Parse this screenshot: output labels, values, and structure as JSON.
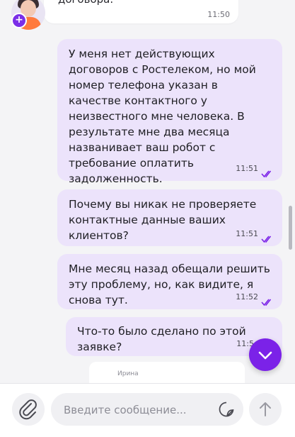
{
  "chat": {
    "incoming_partial": {
      "text": "договора.",
      "time": "11:50"
    },
    "messages": [
      {
        "text": "У меня нет действующих договоров с Ростелеком, но мой номер телефона указан в качестве контактного у неизвестного мне человека. В результате мне два месяца названивает ваш робот с требование оплатить задолженность.",
        "time": "11:51"
      },
      {
        "text": "Почему вы никак не проверяете контактные данные ваших клиентов?",
        "time": "11:51"
      },
      {
        "text": "Мне месяц назад обещали решить эту проблему, но, как видите, я снова тут.",
        "time": "11:52"
      },
      {
        "text": "Что-то было сделано по этой заявке?",
        "time": "11:5"
      }
    ],
    "preview_name": "Ирина"
  },
  "composer": {
    "placeholder": "Введите сообщение..."
  },
  "colors": {
    "accent": "#7b22e8",
    "outgoing_bubble": "#ece3fb",
    "incoming_bubble": "#ffffff",
    "background": "#f4f4f6"
  },
  "icons": {
    "attach": "paperclip-icon",
    "emoji": "sticker-icon",
    "send": "arrow-up-icon",
    "scroll": "chevron-down-icon",
    "read": "double-check-icon"
  }
}
